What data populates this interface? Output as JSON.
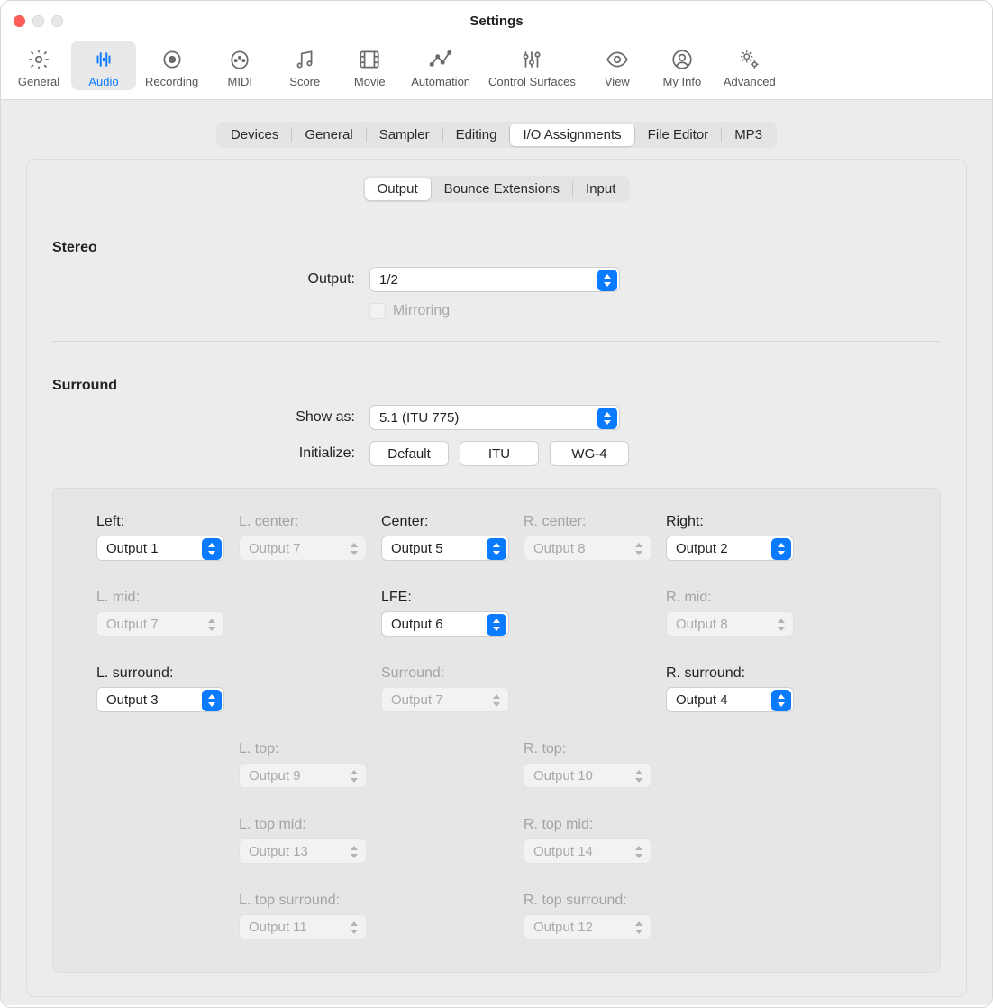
{
  "window": {
    "title": "Settings"
  },
  "toolbar": [
    {
      "id": "general",
      "label": "General",
      "icon": "gear"
    },
    {
      "id": "audio",
      "label": "Audio",
      "icon": "waveform",
      "active": true
    },
    {
      "id": "recording",
      "label": "Recording",
      "icon": "record"
    },
    {
      "id": "midi",
      "label": "MIDI",
      "icon": "midi-plug"
    },
    {
      "id": "score",
      "label": "Score",
      "icon": "notes"
    },
    {
      "id": "movie",
      "label": "Movie",
      "icon": "film"
    },
    {
      "id": "automation",
      "label": "Automation",
      "icon": "automation"
    },
    {
      "id": "surfaces",
      "label": "Control Surfaces",
      "icon": "sliders"
    },
    {
      "id": "view",
      "label": "View",
      "icon": "eye"
    },
    {
      "id": "myinfo",
      "label": "My Info",
      "icon": "person"
    },
    {
      "id": "advanced",
      "label": "Advanced",
      "icon": "gears"
    }
  ],
  "seg_top": {
    "items": [
      "Devices",
      "General",
      "Sampler",
      "Editing",
      "I/O Assignments",
      "File Editor",
      "MP3"
    ],
    "active": "I/O Assignments"
  },
  "seg_io": {
    "items": [
      "Output",
      "Bounce Extensions",
      "Input"
    ],
    "active": "Output"
  },
  "stereo": {
    "title": "Stereo",
    "output_label": "Output:",
    "output_value": "1/2",
    "mirroring_label": "Mirroring",
    "mirroring_enabled": false
  },
  "surround": {
    "title": "Surround",
    "showas_label": "Show as:",
    "showas_value": "5.1 (ITU 775)",
    "initialize_label": "Initialize:",
    "buttons": [
      "Default",
      "ITU",
      "WG-4"
    ]
  },
  "channels": {
    "row1": [
      {
        "label": "Left:",
        "value": "Output 1",
        "enabled": true
      },
      {
        "label": "L. center:",
        "value": "Output 7",
        "enabled": false
      },
      {
        "label": "Center:",
        "value": "Output 5",
        "enabled": true
      },
      {
        "label": "R. center:",
        "value": "Output 8",
        "enabled": false
      },
      {
        "label": "Right:",
        "value": "Output 2",
        "enabled": true
      }
    ],
    "row2": [
      {
        "label": "L. mid:",
        "value": "Output 7",
        "enabled": false
      },
      null,
      {
        "label": "LFE:",
        "value": "Output 6",
        "enabled": true
      },
      null,
      {
        "label": "R. mid:",
        "value": "Output 8",
        "enabled": false
      }
    ],
    "row3": [
      {
        "label": "L. surround:",
        "value": "Output 3",
        "enabled": true
      },
      null,
      {
        "label": "Surround:",
        "value": "Output 7",
        "enabled": false
      },
      null,
      {
        "label": "R. surround:",
        "value": "Output 4",
        "enabled": true
      }
    ],
    "row4": [
      null,
      {
        "label": "L. top:",
        "value": "Output 9",
        "enabled": false
      },
      null,
      {
        "label": "R. top:",
        "value": "Output 10",
        "enabled": false
      },
      null
    ],
    "row5": [
      null,
      {
        "label": "L. top mid:",
        "value": "Output 13",
        "enabled": false
      },
      null,
      {
        "label": "R. top mid:",
        "value": "Output 14",
        "enabled": false
      },
      null
    ],
    "row6": [
      null,
      {
        "label": "L. top surround:",
        "value": "Output 11",
        "enabled": false
      },
      null,
      {
        "label": "R. top surround:",
        "value": "Output 12",
        "enabled": false
      },
      null
    ]
  }
}
